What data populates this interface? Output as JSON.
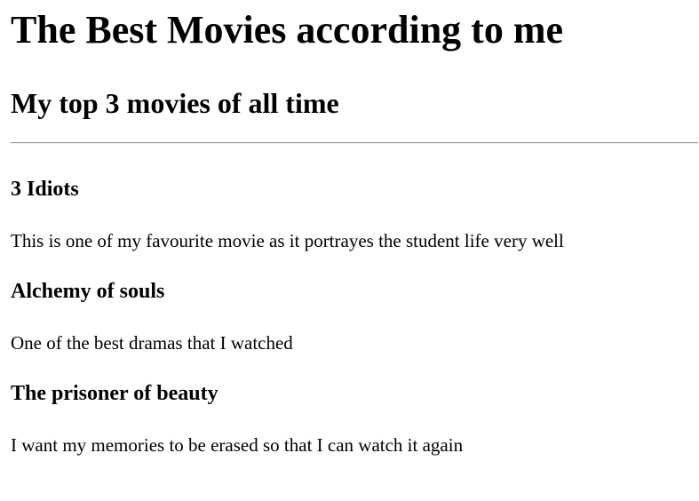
{
  "page": {
    "title": "The Best Movies according to me",
    "subtitle": "My top 3 movies of all time"
  },
  "movies": [
    {
      "title": "3 Idiots",
      "description": "This is one of my favourite movie as it portrayes the student life very well"
    },
    {
      "title": "Alchemy of souls",
      "description": "One of the best dramas that I watched"
    },
    {
      "title": "The prisoner of beauty",
      "description": "I want my memories to be erased so that I can watch it again"
    }
  ]
}
